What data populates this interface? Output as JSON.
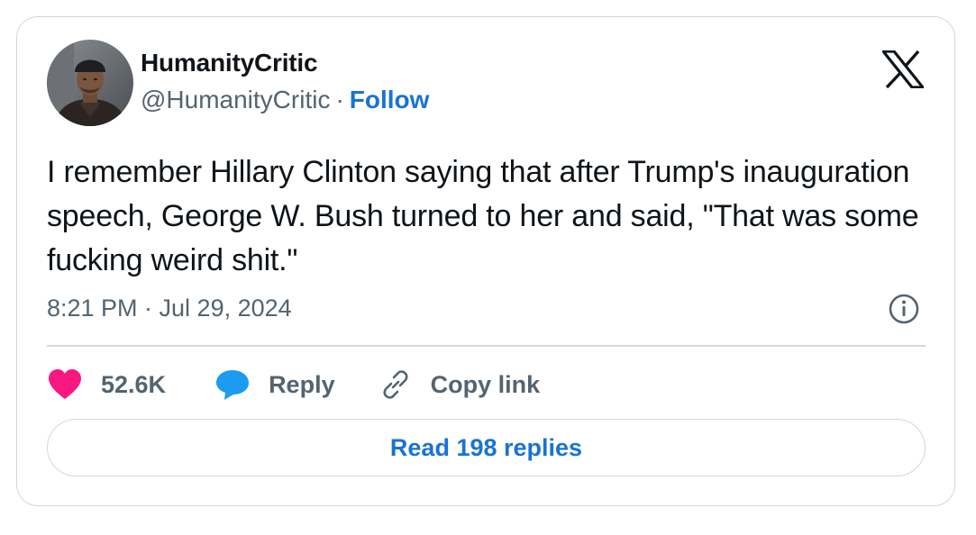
{
  "author": {
    "display_name": "HumanityCritic",
    "handle": "@HumanityCritic",
    "separator": "·",
    "follow_label": "Follow"
  },
  "tweet": {
    "text": "I remember Hillary Clinton saying that after Trump's inauguration speech, George W. Bush turned to her and said, \"That was some fucking weird shit.\"",
    "timestamp": "8:21 PM · Jul 29, 2024"
  },
  "actions": {
    "like_count": "52.6K",
    "reply_label": "Reply",
    "copy_link_label": "Copy link"
  },
  "read_replies_label": "Read 198 replies",
  "icons": {
    "logo": "x-logo-icon",
    "info": "info-icon",
    "like": "heart-icon",
    "reply": "speech-bubble-icon",
    "copy": "link-icon"
  },
  "colors": {
    "link_blue": "#1a73d3",
    "heart_pink": "#f91880",
    "reply_blue": "#1d9bf0",
    "secondary_text": "#536471",
    "border": "#cfd9de"
  }
}
